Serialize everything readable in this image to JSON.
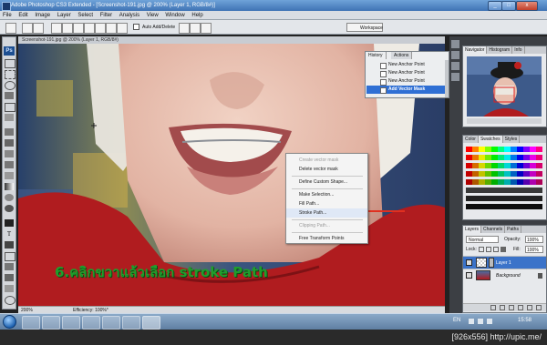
{
  "window": {
    "title": "Adobe Photoshop CS3 Extended - [Screenshot-191.jpg @ 200% (Layer 1, RGB/8#)]",
    "controls": [
      "_",
      "□",
      "x"
    ]
  },
  "menu": [
    "File",
    "Edit",
    "Image",
    "Layer",
    "Select",
    "Filter",
    "Analysis",
    "View",
    "Window",
    "Help"
  ],
  "options_bar": {
    "auto_add_delete": "Auto Add/Delete",
    "workspace": "Workspace"
  },
  "toolbox": {
    "logo": "Ps"
  },
  "document": {
    "tab": "Screenshot-191.jpg @ 200% (Layer 1, RGB/8#)"
  },
  "status_bar": {
    "zoom": "200%",
    "info": "Efficiency: 100%*"
  },
  "history": {
    "tabs": [
      "History",
      "Actions"
    ],
    "rows": [
      "New Anchor Point",
      "New Anchor Point",
      "New Anchor Point",
      "Add Vector Mask"
    ]
  },
  "context_menu": {
    "items": [
      {
        "label": "Create vector mask",
        "disabled": true
      },
      {
        "label": "Delete vector mask",
        "disabled": false
      },
      {
        "label": "Define Custom Shape...",
        "disabled": false
      },
      {
        "label": "Make Selection...",
        "disabled": false
      },
      {
        "label": "Fill Path...",
        "disabled": false
      },
      {
        "label": "Stroke Path...",
        "disabled": false,
        "highlighted": true
      },
      {
        "label": "Clipping Path...",
        "disabled": true
      },
      {
        "label": "Free Transform Points",
        "disabled": false
      }
    ]
  },
  "annotation": {
    "text": "6.คลิกขวาแล้วเลือก stroke Path",
    "color": "#1f9e2c",
    "arrow_color": "#e03020"
  },
  "navigator": {
    "tabs": [
      "Navigator",
      "Histogram",
      "Info"
    ]
  },
  "swatches": {
    "tabs": [
      "Color",
      "Swatches",
      "Styles"
    ]
  },
  "layers": {
    "tabs": [
      "Layers",
      "Channels",
      "Paths"
    ],
    "blend_mode": "Normal",
    "opacity_label": "Opacity:",
    "opacity": "100%",
    "lock_label": "Lock:",
    "fill_label": "Fill:",
    "fill": "100%",
    "rows": [
      {
        "name": "Layer 1",
        "selected": true
      },
      {
        "name": "Background",
        "selected": false
      }
    ]
  },
  "taskbar": {
    "lang": "EN",
    "time": "15:58"
  },
  "footer": {
    "caption": "[926x556]  http://upic.me/"
  }
}
